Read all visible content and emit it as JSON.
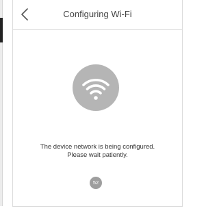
{
  "header": {
    "back_icon": "chevron-left-icon",
    "title": "Configuring Wi-Fi"
  },
  "main": {
    "status_icon": "wifi-icon",
    "message_line1": "The device network is being configured.",
    "message_line2": "Please wait patiently.",
    "countdown": "52"
  },
  "colors": {
    "icon_circle": "#b5b5b5",
    "countdown_badge": "#9e9e9e",
    "text": "#333333"
  }
}
